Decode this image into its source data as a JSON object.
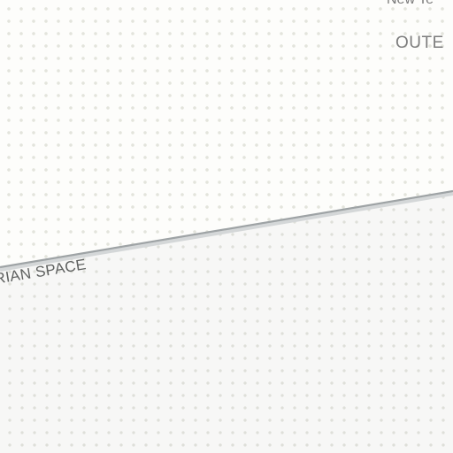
{
  "map": {
    "labels": {
      "top_partial": "New Te",
      "outer_partial": "OUTE",
      "space_partial": "RIAN SPACE"
    },
    "colors": {
      "background": "#fdfdfb",
      "dots_upper": "#e3e4dc",
      "lower_area": "#f7f7f6",
      "dots_lower": "#dedfd9",
      "boundary_line": "#9ea3a5",
      "label_text": "#6b6b6b"
    }
  }
}
